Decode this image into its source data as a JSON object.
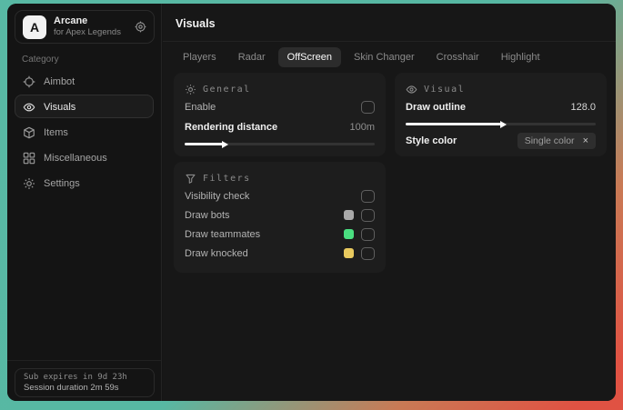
{
  "app": {
    "logo_letter": "A",
    "name": "Arcane",
    "subtitle": "for Apex Legends"
  },
  "sidebar": {
    "category_label": "Category",
    "items": [
      {
        "label": "Aimbot"
      },
      {
        "label": "Visuals"
      },
      {
        "label": "Items"
      },
      {
        "label": "Miscellaneous"
      },
      {
        "label": "Settings"
      }
    ],
    "footer": {
      "sub_expires": "Sub expires in 9d 23h",
      "session_duration": "Session duration 2m 59s"
    }
  },
  "main": {
    "title": "Visuals",
    "tabs": [
      {
        "label": "Players"
      },
      {
        "label": "Radar"
      },
      {
        "label": "OffScreen"
      },
      {
        "label": "Skin Changer"
      },
      {
        "label": "Crosshair"
      },
      {
        "label": "Highlight"
      }
    ],
    "panels": {
      "general": {
        "title": "General",
        "enable_label": "Enable",
        "rendering_label": "Rendering distance",
        "rendering_value": "100m",
        "slider_fill": "20%"
      },
      "visual": {
        "title": "Visual",
        "outline_label": "Draw outline",
        "outline_value": "128.0",
        "slider_fill": "50%",
        "style_label": "Style color",
        "style_chip_label": "Single color",
        "style_chip_close": "×"
      },
      "filters": {
        "title": "Filters",
        "rows": [
          {
            "label": "Visibility check"
          },
          {
            "label": "Draw bots",
            "swatch": "#a9a9a9"
          },
          {
            "label": "Draw teammates",
            "swatch": "#4ade80"
          },
          {
            "label": "Draw knocked",
            "swatch": "#e8c95e"
          }
        ]
      }
    }
  },
  "colors": {
    "background_teal": "#58b9a4",
    "background_red": "#e05243",
    "swatch_bots": "#a9a9a9",
    "swatch_teammates": "#4ade80",
    "swatch_knocked": "#e8c95e"
  }
}
